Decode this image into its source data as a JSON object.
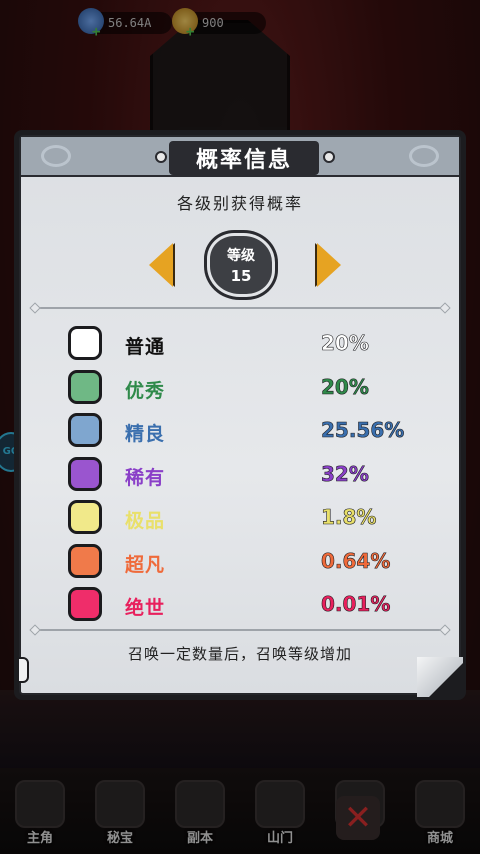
{
  "resources": [
    {
      "icon": "gem-icon",
      "value": "56.64A"
    },
    {
      "icon": "gold-icon",
      "value": "900"
    }
  ],
  "bottom_nav": [
    {
      "label": "主角",
      "icon": "hero-icon"
    },
    {
      "label": "秘宝",
      "icon": "treasure-icon"
    },
    {
      "label": "副本",
      "icon": "dungeon-icon"
    },
    {
      "label": "山门",
      "icon": "gate-icon"
    },
    {
      "label": "",
      "icon": "close-icon"
    },
    {
      "label": "商城",
      "icon": "shop-icon"
    }
  ],
  "modal": {
    "title": "概率信息",
    "subtitle": "各级别获得概率",
    "level_label": "等级",
    "level_value": "15",
    "rows": [
      {
        "name": "普通",
        "percent": "20%",
        "color": "#ffffff",
        "text_color": "#111111"
      },
      {
        "name": "优秀",
        "percent": "20%",
        "color": "#6fb885",
        "text_color": "#2f8a4a"
      },
      {
        "name": "精良",
        "percent": "25.56%",
        "color": "#7fa6cf",
        "text_color": "#3a6fae"
      },
      {
        "name": "稀有",
        "percent": "32%",
        "color": "#9a55cf",
        "text_color": "#8a3fc8"
      },
      {
        "name": "极品",
        "percent": "1.8%",
        "color": "#f1e98a",
        "text_color": "#e9e06a"
      },
      {
        "name": "超凡",
        "percent": "0.64%",
        "color": "#f07a4a",
        "text_color": "#ef6a3a"
      },
      {
        "name": "绝世",
        "percent": "0.01%",
        "color": "#ef2d6a",
        "text_color": "#e8205d"
      }
    ],
    "footer": "召唤一定数量后，召唤等级增加"
  }
}
